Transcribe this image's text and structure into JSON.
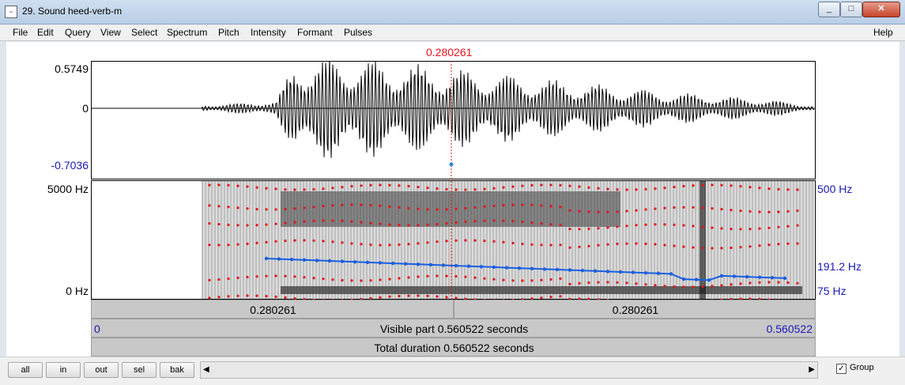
{
  "window": {
    "title": "29. Sound heed-verb-m"
  },
  "menu": {
    "items": [
      "File",
      "Edit",
      "Query",
      "View",
      "Select",
      "Spectrum",
      "Pitch",
      "Intensity",
      "Formant",
      "Pulses"
    ],
    "help": "Help"
  },
  "waveform": {
    "cursor_time": "0.280261",
    "y_max": "0.5749",
    "y_zero": "0",
    "y_min": "-0.7036"
  },
  "spectrogram": {
    "freq_max": "5000 Hz",
    "freq_min": "0 Hz",
    "pitch_max": "500 Hz",
    "pitch_current": "191.2 Hz",
    "pitch_min": "75 Hz"
  },
  "timebars": {
    "left_segment": "0.280261",
    "right_segment": "0.280261",
    "start": "0",
    "end": "0.560522",
    "visible_part": "Visible part 0.560522 seconds",
    "total_duration": "Total duration 0.560522 seconds"
  },
  "buttons": {
    "all": "all",
    "in": "in",
    "out": "out",
    "sel": "sel",
    "bak": "bak"
  },
  "group": {
    "label": "Group",
    "checked": "✓"
  },
  "colors": {
    "pitch": "#1a5fe0",
    "formant": "#e0141e",
    "cursor": "#e0141e"
  }
}
